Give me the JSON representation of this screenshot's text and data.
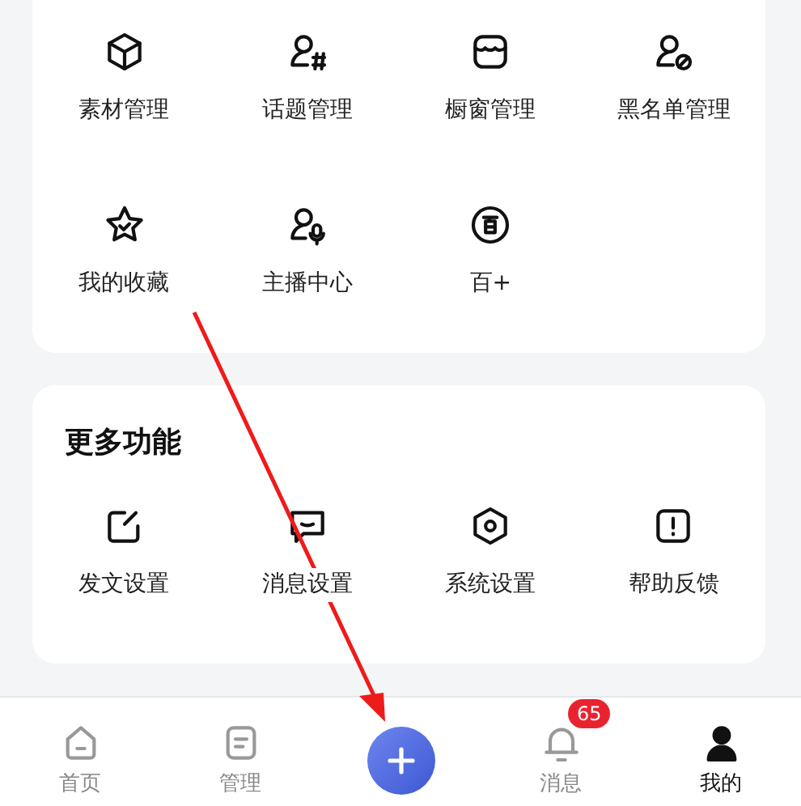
{
  "tool_grid": {
    "items": [
      {
        "label": "素材管理"
      },
      {
        "label": "话题管理"
      },
      {
        "label": "橱窗管理"
      },
      {
        "label": "黑名单管理"
      },
      {
        "label": "我的收藏"
      },
      {
        "label": "主播中心"
      },
      {
        "label": "百+"
      }
    ]
  },
  "more_section": {
    "title": "更多功能",
    "items": [
      {
        "label": "发文设置"
      },
      {
        "label": "消息设置"
      },
      {
        "label": "系统设置"
      },
      {
        "label": "帮助反馈"
      }
    ]
  },
  "tab_bar": {
    "tabs": [
      {
        "kind": "tab",
        "label": "首页",
        "selected": false
      },
      {
        "kind": "tab",
        "label": "管理",
        "selected": false
      },
      {
        "kind": "action"
      },
      {
        "kind": "tab",
        "label": "消息",
        "selected": false,
        "badge": "65"
      },
      {
        "kind": "tab",
        "label": "我的",
        "selected": true
      }
    ]
  },
  "annotation": {
    "kind": "arrow"
  }
}
